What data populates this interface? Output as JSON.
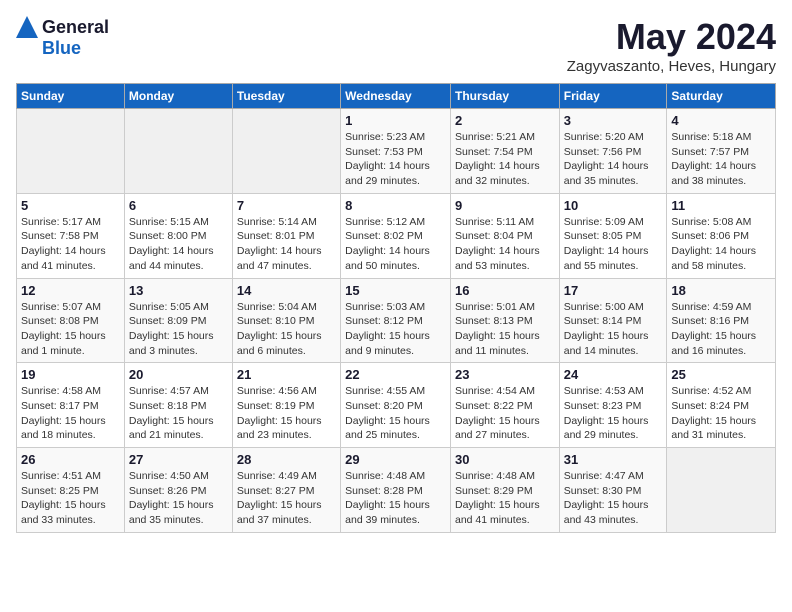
{
  "header": {
    "logo_general": "General",
    "logo_blue": "Blue",
    "month": "May 2024",
    "location": "Zagyvaszanto, Heves, Hungary"
  },
  "weekdays": [
    "Sunday",
    "Monday",
    "Tuesday",
    "Wednesday",
    "Thursday",
    "Friday",
    "Saturday"
  ],
  "weeks": [
    [
      {
        "day": "",
        "info": ""
      },
      {
        "day": "",
        "info": ""
      },
      {
        "day": "",
        "info": ""
      },
      {
        "day": "1",
        "info": "Sunrise: 5:23 AM\nSunset: 7:53 PM\nDaylight: 14 hours\nand 29 minutes."
      },
      {
        "day": "2",
        "info": "Sunrise: 5:21 AM\nSunset: 7:54 PM\nDaylight: 14 hours\nand 32 minutes."
      },
      {
        "day": "3",
        "info": "Sunrise: 5:20 AM\nSunset: 7:56 PM\nDaylight: 14 hours\nand 35 minutes."
      },
      {
        "day": "4",
        "info": "Sunrise: 5:18 AM\nSunset: 7:57 PM\nDaylight: 14 hours\nand 38 minutes."
      }
    ],
    [
      {
        "day": "5",
        "info": "Sunrise: 5:17 AM\nSunset: 7:58 PM\nDaylight: 14 hours\nand 41 minutes."
      },
      {
        "day": "6",
        "info": "Sunrise: 5:15 AM\nSunset: 8:00 PM\nDaylight: 14 hours\nand 44 minutes."
      },
      {
        "day": "7",
        "info": "Sunrise: 5:14 AM\nSunset: 8:01 PM\nDaylight: 14 hours\nand 47 minutes."
      },
      {
        "day": "8",
        "info": "Sunrise: 5:12 AM\nSunset: 8:02 PM\nDaylight: 14 hours\nand 50 minutes."
      },
      {
        "day": "9",
        "info": "Sunrise: 5:11 AM\nSunset: 8:04 PM\nDaylight: 14 hours\nand 53 minutes."
      },
      {
        "day": "10",
        "info": "Sunrise: 5:09 AM\nSunset: 8:05 PM\nDaylight: 14 hours\nand 55 minutes."
      },
      {
        "day": "11",
        "info": "Sunrise: 5:08 AM\nSunset: 8:06 PM\nDaylight: 14 hours\nand 58 minutes."
      }
    ],
    [
      {
        "day": "12",
        "info": "Sunrise: 5:07 AM\nSunset: 8:08 PM\nDaylight: 15 hours\nand 1 minute."
      },
      {
        "day": "13",
        "info": "Sunrise: 5:05 AM\nSunset: 8:09 PM\nDaylight: 15 hours\nand 3 minutes."
      },
      {
        "day": "14",
        "info": "Sunrise: 5:04 AM\nSunset: 8:10 PM\nDaylight: 15 hours\nand 6 minutes."
      },
      {
        "day": "15",
        "info": "Sunrise: 5:03 AM\nSunset: 8:12 PM\nDaylight: 15 hours\nand 9 minutes."
      },
      {
        "day": "16",
        "info": "Sunrise: 5:01 AM\nSunset: 8:13 PM\nDaylight: 15 hours\nand 11 minutes."
      },
      {
        "day": "17",
        "info": "Sunrise: 5:00 AM\nSunset: 8:14 PM\nDaylight: 15 hours\nand 14 minutes."
      },
      {
        "day": "18",
        "info": "Sunrise: 4:59 AM\nSunset: 8:16 PM\nDaylight: 15 hours\nand 16 minutes."
      }
    ],
    [
      {
        "day": "19",
        "info": "Sunrise: 4:58 AM\nSunset: 8:17 PM\nDaylight: 15 hours\nand 18 minutes."
      },
      {
        "day": "20",
        "info": "Sunrise: 4:57 AM\nSunset: 8:18 PM\nDaylight: 15 hours\nand 21 minutes."
      },
      {
        "day": "21",
        "info": "Sunrise: 4:56 AM\nSunset: 8:19 PM\nDaylight: 15 hours\nand 23 minutes."
      },
      {
        "day": "22",
        "info": "Sunrise: 4:55 AM\nSunset: 8:20 PM\nDaylight: 15 hours\nand 25 minutes."
      },
      {
        "day": "23",
        "info": "Sunrise: 4:54 AM\nSunset: 8:22 PM\nDaylight: 15 hours\nand 27 minutes."
      },
      {
        "day": "24",
        "info": "Sunrise: 4:53 AM\nSunset: 8:23 PM\nDaylight: 15 hours\nand 29 minutes."
      },
      {
        "day": "25",
        "info": "Sunrise: 4:52 AM\nSunset: 8:24 PM\nDaylight: 15 hours\nand 31 minutes."
      }
    ],
    [
      {
        "day": "26",
        "info": "Sunrise: 4:51 AM\nSunset: 8:25 PM\nDaylight: 15 hours\nand 33 minutes."
      },
      {
        "day": "27",
        "info": "Sunrise: 4:50 AM\nSunset: 8:26 PM\nDaylight: 15 hours\nand 35 minutes."
      },
      {
        "day": "28",
        "info": "Sunrise: 4:49 AM\nSunset: 8:27 PM\nDaylight: 15 hours\nand 37 minutes."
      },
      {
        "day": "29",
        "info": "Sunrise: 4:48 AM\nSunset: 8:28 PM\nDaylight: 15 hours\nand 39 minutes."
      },
      {
        "day": "30",
        "info": "Sunrise: 4:48 AM\nSunset: 8:29 PM\nDaylight: 15 hours\nand 41 minutes."
      },
      {
        "day": "31",
        "info": "Sunrise: 4:47 AM\nSunset: 8:30 PM\nDaylight: 15 hours\nand 43 minutes."
      },
      {
        "day": "",
        "info": ""
      }
    ]
  ]
}
